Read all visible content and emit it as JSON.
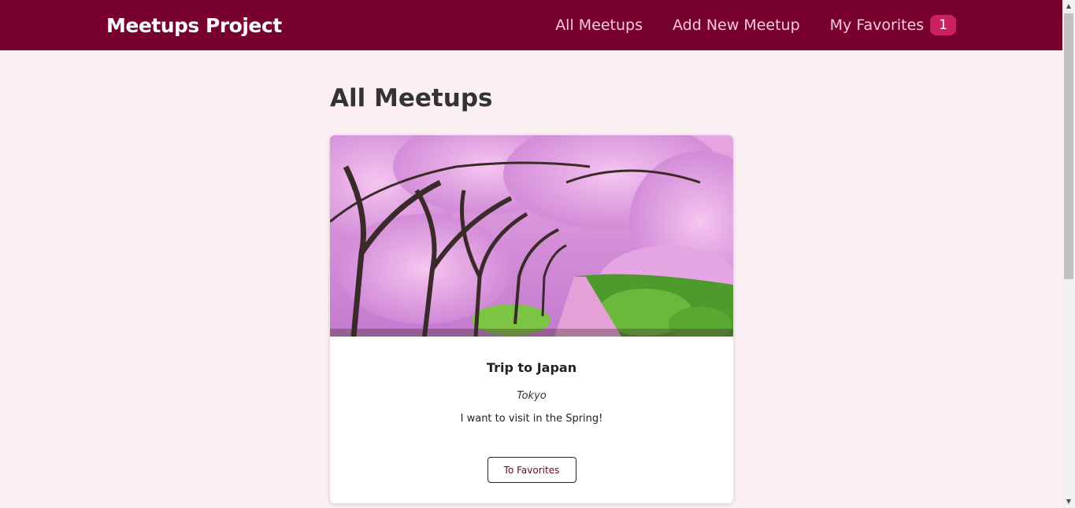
{
  "header": {
    "logo": "Meetups Project",
    "nav": {
      "all_meetups": "All Meetups",
      "add_new_meetup": "Add New Meetup",
      "my_favorites": "My Favorites",
      "favorites_count": "1"
    }
  },
  "main": {
    "title": "All Meetups",
    "meetups": [
      {
        "title": "Trip to Japan",
        "address": "Tokyo",
        "description": "I want to visit in the Spring!",
        "button_label": "To Favorites",
        "image_alt": "cherry blossom path"
      }
    ]
  },
  "colors": {
    "header_bg": "#77002e",
    "page_bg": "#fcf0f4",
    "badge_bg": "#cc2062",
    "nav_text": "#fcc8dc"
  }
}
